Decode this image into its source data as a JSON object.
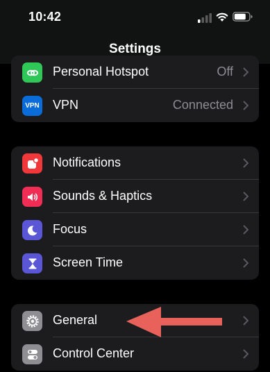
{
  "status_bar": {
    "time": "10:42"
  },
  "nav": {
    "title": "Settings"
  },
  "group1": [
    {
      "label": "Personal Hotspot",
      "value": "Off",
      "icon": "hotspot-icon",
      "color": "#30c759"
    },
    {
      "label": "VPN",
      "value": "Connected",
      "icon": "vpn-icon",
      "icon_text": "VPN",
      "color": "#0a6cd9"
    }
  ],
  "group2": [
    {
      "label": "Notifications",
      "icon": "notifications-icon",
      "color": "#f0383b"
    },
    {
      "label": "Sounds & Haptics",
      "icon": "speaker-icon",
      "color": "#f02d55"
    },
    {
      "label": "Focus",
      "icon": "moon-icon",
      "color": "#5a56d6"
    },
    {
      "label": "Screen Time",
      "icon": "hourglass-icon",
      "color": "#5a56d6"
    }
  ],
  "group3": [
    {
      "label": "General",
      "icon": "gear-icon",
      "color": "#8e8e93"
    },
    {
      "label": "Control Center",
      "icon": "toggles-icon",
      "color": "#8e8e93"
    }
  ],
  "annotation": {
    "arrow_color": "#e8625b",
    "target": "General"
  }
}
